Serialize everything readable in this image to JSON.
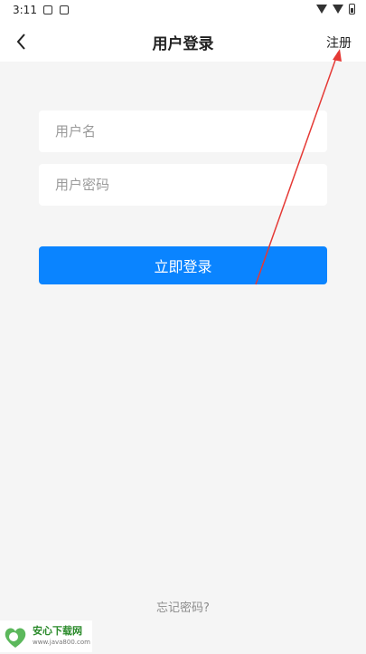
{
  "status_bar": {
    "time": "3:11"
  },
  "nav": {
    "title": "用户登录",
    "register_label": "注册"
  },
  "form": {
    "username_placeholder": "用户名",
    "password_placeholder": "用户密码",
    "login_label": "立即登录"
  },
  "footer": {
    "forgot_label": "忘记密码?"
  },
  "watermark": {
    "name": "安心下载网",
    "url": "www.java800.com"
  },
  "colors": {
    "primary": "#0a84ff",
    "background": "#f5f5f5",
    "annotation_arrow": "#e53935"
  }
}
